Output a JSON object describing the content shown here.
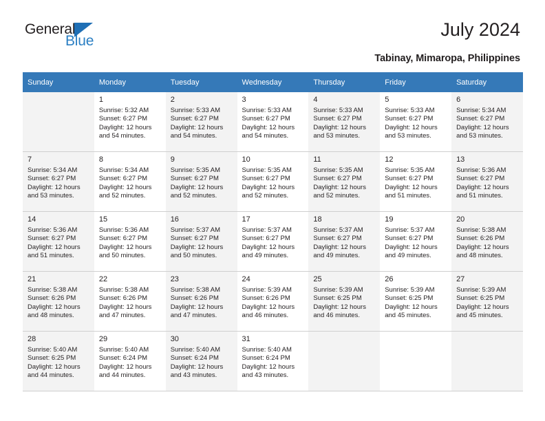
{
  "brand": {
    "word1": "General",
    "word2": "Blue",
    "triangle_color": "#1f6fb5",
    "blue_text_color": "#2b7fc3"
  },
  "header": {
    "title": "July 2024",
    "location": "Tabinay, Mimaropa, Philippines"
  },
  "theme": {
    "header_row_bg": "#3579b8",
    "header_row_text": "#ffffff",
    "shaded_cell_bg": "#f3f3f3",
    "cell_border": "#cfcfcf",
    "text": "#231f20"
  },
  "weekday_headers": [
    "Sunday",
    "Monday",
    "Tuesday",
    "Wednesday",
    "Thursday",
    "Friday",
    "Saturday"
  ],
  "weeks": [
    [
      {
        "day": "",
        "sunrise": "",
        "sunset": "",
        "daylight_line1": "",
        "daylight_line2": ""
      },
      {
        "day": "1",
        "sunrise": "Sunrise: 5:32 AM",
        "sunset": "Sunset: 6:27 PM",
        "daylight_line1": "Daylight: 12 hours",
        "daylight_line2": "and 54 minutes."
      },
      {
        "day": "2",
        "sunrise": "Sunrise: 5:33 AM",
        "sunset": "Sunset: 6:27 PM",
        "daylight_line1": "Daylight: 12 hours",
        "daylight_line2": "and 54 minutes."
      },
      {
        "day": "3",
        "sunrise": "Sunrise: 5:33 AM",
        "sunset": "Sunset: 6:27 PM",
        "daylight_line1": "Daylight: 12 hours",
        "daylight_line2": "and 54 minutes."
      },
      {
        "day": "4",
        "sunrise": "Sunrise: 5:33 AM",
        "sunset": "Sunset: 6:27 PM",
        "daylight_line1": "Daylight: 12 hours",
        "daylight_line2": "and 53 minutes."
      },
      {
        "day": "5",
        "sunrise": "Sunrise: 5:33 AM",
        "sunset": "Sunset: 6:27 PM",
        "daylight_line1": "Daylight: 12 hours",
        "daylight_line2": "and 53 minutes."
      },
      {
        "day": "6",
        "sunrise": "Sunrise: 5:34 AM",
        "sunset": "Sunset: 6:27 PM",
        "daylight_line1": "Daylight: 12 hours",
        "daylight_line2": "and 53 minutes."
      }
    ],
    [
      {
        "day": "7",
        "sunrise": "Sunrise: 5:34 AM",
        "sunset": "Sunset: 6:27 PM",
        "daylight_line1": "Daylight: 12 hours",
        "daylight_line2": "and 53 minutes."
      },
      {
        "day": "8",
        "sunrise": "Sunrise: 5:34 AM",
        "sunset": "Sunset: 6:27 PM",
        "daylight_line1": "Daylight: 12 hours",
        "daylight_line2": "and 52 minutes."
      },
      {
        "day": "9",
        "sunrise": "Sunrise: 5:35 AM",
        "sunset": "Sunset: 6:27 PM",
        "daylight_line1": "Daylight: 12 hours",
        "daylight_line2": "and 52 minutes."
      },
      {
        "day": "10",
        "sunrise": "Sunrise: 5:35 AM",
        "sunset": "Sunset: 6:27 PM",
        "daylight_line1": "Daylight: 12 hours",
        "daylight_line2": "and 52 minutes."
      },
      {
        "day": "11",
        "sunrise": "Sunrise: 5:35 AM",
        "sunset": "Sunset: 6:27 PM",
        "daylight_line1": "Daylight: 12 hours",
        "daylight_line2": "and 52 minutes."
      },
      {
        "day": "12",
        "sunrise": "Sunrise: 5:35 AM",
        "sunset": "Sunset: 6:27 PM",
        "daylight_line1": "Daylight: 12 hours",
        "daylight_line2": "and 51 minutes."
      },
      {
        "day": "13",
        "sunrise": "Sunrise: 5:36 AM",
        "sunset": "Sunset: 6:27 PM",
        "daylight_line1": "Daylight: 12 hours",
        "daylight_line2": "and 51 minutes."
      }
    ],
    [
      {
        "day": "14",
        "sunrise": "Sunrise: 5:36 AM",
        "sunset": "Sunset: 6:27 PM",
        "daylight_line1": "Daylight: 12 hours",
        "daylight_line2": "and 51 minutes."
      },
      {
        "day": "15",
        "sunrise": "Sunrise: 5:36 AM",
        "sunset": "Sunset: 6:27 PM",
        "daylight_line1": "Daylight: 12 hours",
        "daylight_line2": "and 50 minutes."
      },
      {
        "day": "16",
        "sunrise": "Sunrise: 5:37 AM",
        "sunset": "Sunset: 6:27 PM",
        "daylight_line1": "Daylight: 12 hours",
        "daylight_line2": "and 50 minutes."
      },
      {
        "day": "17",
        "sunrise": "Sunrise: 5:37 AM",
        "sunset": "Sunset: 6:27 PM",
        "daylight_line1": "Daylight: 12 hours",
        "daylight_line2": "and 49 minutes."
      },
      {
        "day": "18",
        "sunrise": "Sunrise: 5:37 AM",
        "sunset": "Sunset: 6:27 PM",
        "daylight_line1": "Daylight: 12 hours",
        "daylight_line2": "and 49 minutes."
      },
      {
        "day": "19",
        "sunrise": "Sunrise: 5:37 AM",
        "sunset": "Sunset: 6:27 PM",
        "daylight_line1": "Daylight: 12 hours",
        "daylight_line2": "and 49 minutes."
      },
      {
        "day": "20",
        "sunrise": "Sunrise: 5:38 AM",
        "sunset": "Sunset: 6:26 PM",
        "daylight_line1": "Daylight: 12 hours",
        "daylight_line2": "and 48 minutes."
      }
    ],
    [
      {
        "day": "21",
        "sunrise": "Sunrise: 5:38 AM",
        "sunset": "Sunset: 6:26 PM",
        "daylight_line1": "Daylight: 12 hours",
        "daylight_line2": "and 48 minutes."
      },
      {
        "day": "22",
        "sunrise": "Sunrise: 5:38 AM",
        "sunset": "Sunset: 6:26 PM",
        "daylight_line1": "Daylight: 12 hours",
        "daylight_line2": "and 47 minutes."
      },
      {
        "day": "23",
        "sunrise": "Sunrise: 5:38 AM",
        "sunset": "Sunset: 6:26 PM",
        "daylight_line1": "Daylight: 12 hours",
        "daylight_line2": "and 47 minutes."
      },
      {
        "day": "24",
        "sunrise": "Sunrise: 5:39 AM",
        "sunset": "Sunset: 6:26 PM",
        "daylight_line1": "Daylight: 12 hours",
        "daylight_line2": "and 46 minutes."
      },
      {
        "day": "25",
        "sunrise": "Sunrise: 5:39 AM",
        "sunset": "Sunset: 6:25 PM",
        "daylight_line1": "Daylight: 12 hours",
        "daylight_line2": "and 46 minutes."
      },
      {
        "day": "26",
        "sunrise": "Sunrise: 5:39 AM",
        "sunset": "Sunset: 6:25 PM",
        "daylight_line1": "Daylight: 12 hours",
        "daylight_line2": "and 45 minutes."
      },
      {
        "day": "27",
        "sunrise": "Sunrise: 5:39 AM",
        "sunset": "Sunset: 6:25 PM",
        "daylight_line1": "Daylight: 12 hours",
        "daylight_line2": "and 45 minutes."
      }
    ],
    [
      {
        "day": "28",
        "sunrise": "Sunrise: 5:40 AM",
        "sunset": "Sunset: 6:25 PM",
        "daylight_line1": "Daylight: 12 hours",
        "daylight_line2": "and 44 minutes."
      },
      {
        "day": "29",
        "sunrise": "Sunrise: 5:40 AM",
        "sunset": "Sunset: 6:24 PM",
        "daylight_line1": "Daylight: 12 hours",
        "daylight_line2": "and 44 minutes."
      },
      {
        "day": "30",
        "sunrise": "Sunrise: 5:40 AM",
        "sunset": "Sunset: 6:24 PM",
        "daylight_line1": "Daylight: 12 hours",
        "daylight_line2": "and 43 minutes."
      },
      {
        "day": "31",
        "sunrise": "Sunrise: 5:40 AM",
        "sunset": "Sunset: 6:24 PM",
        "daylight_line1": "Daylight: 12 hours",
        "daylight_line2": "and 43 minutes."
      },
      {
        "day": "",
        "sunrise": "",
        "sunset": "",
        "daylight_line1": "",
        "daylight_line2": ""
      },
      {
        "day": "",
        "sunrise": "",
        "sunset": "",
        "daylight_line1": "",
        "daylight_line2": ""
      },
      {
        "day": "",
        "sunrise": "",
        "sunset": "",
        "daylight_line1": "",
        "daylight_line2": ""
      }
    ]
  ]
}
